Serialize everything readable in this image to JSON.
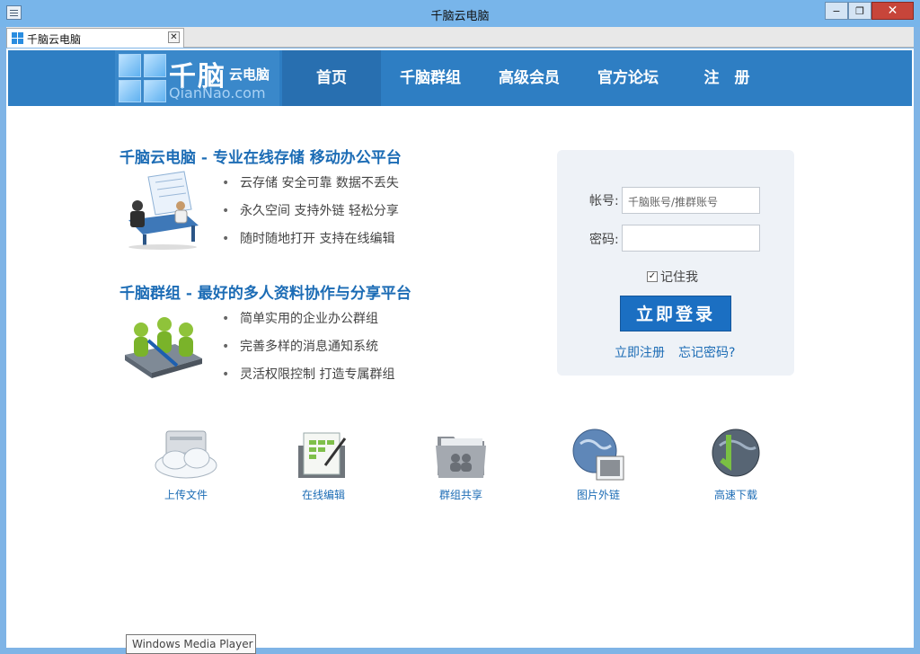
{
  "window": {
    "title": "千脑云电脑",
    "min": "−",
    "max": "❐",
    "close": "✕"
  },
  "tab": {
    "label": "千脑云电脑",
    "close": "✕"
  },
  "header": {
    "logo_main": "千脑",
    "logo_sub": "云电脑",
    "logo_en": "QianNao.com",
    "nav": [
      "首页",
      "千脑群组",
      "高级会员",
      "官方论坛",
      "注　册"
    ]
  },
  "features": [
    {
      "title": "千脑云电脑 - 专业在线存储 移动办公平台",
      "bullets": [
        "云存储 安全可靠 数据不丢失",
        "永久空间 支持外链 轻松分享",
        "随时随地打开 支持在线编辑"
      ]
    },
    {
      "title": "千脑群组 - 最好的多人资料协作与分享平台",
      "bullets": [
        "简单实用的企业办公群组",
        "完善多样的消息通知系统",
        "灵活权限控制 打造专属群组"
      ]
    }
  ],
  "login": {
    "account_label": "帐号:",
    "account_placeholder": "千脑账号/推群账号",
    "password_label": "密码:",
    "remember_label": "记住我",
    "remember_checked": true,
    "submit": "立即登录",
    "register_link": "立即注册",
    "forgot_link": "忘记密码?"
  },
  "tools": [
    "上传文件",
    "在线编辑",
    "群组共享",
    "图片外链",
    "高速下载"
  ],
  "tooltip": "Windows Media Player",
  "colors": {
    "nav_bg": "#2e7ec3",
    "accent": "#1c6cb5",
    "button": "#1b6fc2"
  }
}
